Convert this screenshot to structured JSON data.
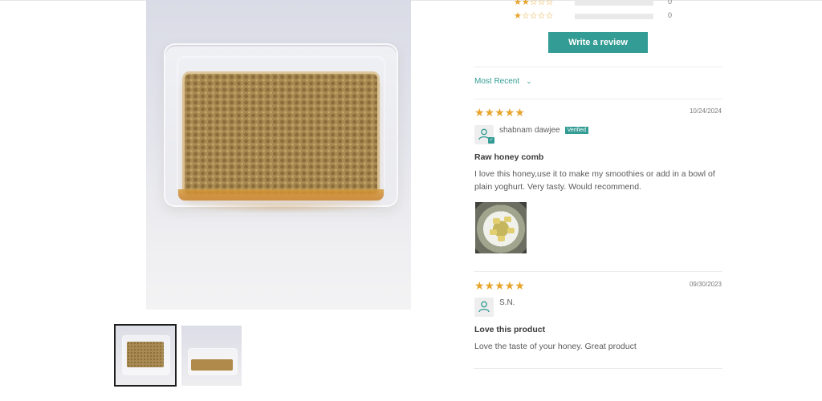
{
  "colors": {
    "accent": "#339c94",
    "star": "#e8a42b"
  },
  "gallery": {
    "main_image_alt": "honeycomb-in-plastic-tray",
    "thumbnails": [
      {
        "name": "thumbnail-honeycomb-top",
        "selected": true
      },
      {
        "name": "thumbnail-honeycomb-side",
        "selected": false
      }
    ]
  },
  "histogram": [
    {
      "stars": "★★☆☆☆",
      "count": "0"
    },
    {
      "stars": "★☆☆☆☆",
      "count": "0"
    }
  ],
  "write_review_label": "Write a review",
  "sort": {
    "label": "Most Recent",
    "icon": "chevron-down-icon"
  },
  "reviews": [
    {
      "stars": "★★★★★",
      "date": "10/24/2024",
      "author": "shabnam dawjee",
      "badge": "Verified",
      "title": "Raw honey comb",
      "body": "I love this honey,use it to make my smoothies or add in a bowl of plain yoghurt. Very tasty. Would recommend.",
      "has_photo": true
    },
    {
      "stars": "★★★★★",
      "date": "09/30/2023",
      "author": "S.N.",
      "badge": "",
      "title": "Love this product",
      "body": "Love the taste of your honey. Great product",
      "has_photo": false
    }
  ]
}
